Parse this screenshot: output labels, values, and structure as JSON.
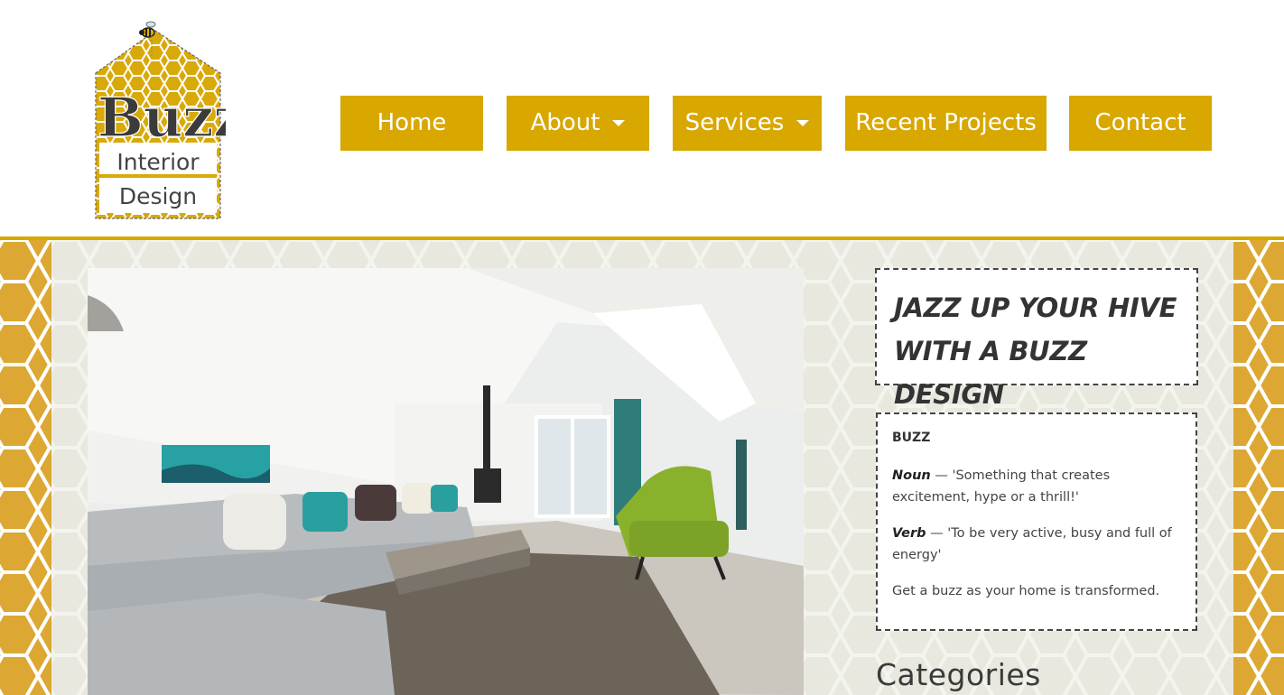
{
  "logo": {
    "text_main": "Buzz",
    "text_line1": "Interior",
    "text_line2": "Design"
  },
  "nav": {
    "items": [
      {
        "label": "Home",
        "has_dropdown": false
      },
      {
        "label": "About",
        "has_dropdown": true
      },
      {
        "label": "Services",
        "has_dropdown": true
      },
      {
        "label": "Recent Projects",
        "has_dropdown": false
      },
      {
        "label": "Contact",
        "has_dropdown": false
      }
    ]
  },
  "colors": {
    "brand_gold": "#d8a700",
    "honeycomb_gold": "#dca833",
    "panel_bg": "#e9e8df"
  },
  "hero": {
    "image_name": "living-room-photo"
  },
  "tagline": {
    "line1": "JAZZ UP YOUR HIVE",
    "line2": "WITH A BUZZ DESIGN"
  },
  "definition": {
    "title": "BUZZ",
    "noun_label": "Noun",
    "noun_text": " — 'Something that creates excitement, hype or a thrill!'",
    "verb_label": "Verb",
    "verb_text": " — 'To be very active, busy and full of energy'",
    "closing": "Get a buzz as your home is transformed."
  },
  "sidebar": {
    "categories_title": "Categories"
  }
}
